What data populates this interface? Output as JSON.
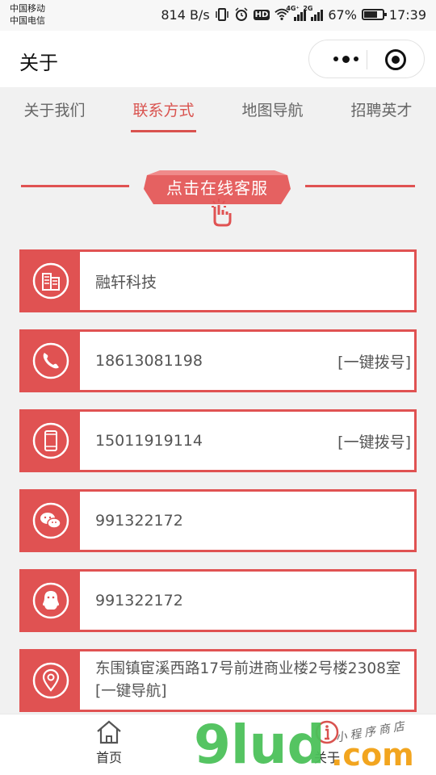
{
  "status_bar": {
    "carrier_1": "中国移动",
    "carrier_2": "中国电信",
    "net_speed": "814 B/s",
    "net_4g": "4G⁺",
    "net_2g": "2G",
    "battery": "67%",
    "time": "17:39"
  },
  "nav": {
    "title": "关于"
  },
  "tabs": [
    {
      "label": "关于我们",
      "active": false
    },
    {
      "label": "联系方式",
      "active": true
    },
    {
      "label": "地图导航",
      "active": false
    },
    {
      "label": "招聘英才",
      "active": false
    }
  ],
  "service_banner": {
    "label": "点击在线客服"
  },
  "contacts": [
    {
      "icon": "building-icon",
      "value": "融轩科技",
      "action": ""
    },
    {
      "icon": "phone-icon",
      "value": "18613081198",
      "action": "[一键拨号]"
    },
    {
      "icon": "mobile-icon",
      "value": "15011919114",
      "action": "[一键拨号]"
    },
    {
      "icon": "wechat-icon",
      "value": "991322172",
      "action": ""
    },
    {
      "icon": "qq-icon",
      "value": "991322172",
      "action": ""
    },
    {
      "icon": "location-icon",
      "value": "东围镇宦溪西路17号前进商业楼2号楼2308室 [一键导航]",
      "action": ""
    }
  ],
  "tabbar": {
    "home_label": "首页",
    "about_label": "关于"
  },
  "watermark": {
    "brand": "9lud",
    "suffix": ".com",
    "slogan": "小程序商店"
  },
  "colors": {
    "accent": "#e05252",
    "active_tab": "#d9534f"
  }
}
